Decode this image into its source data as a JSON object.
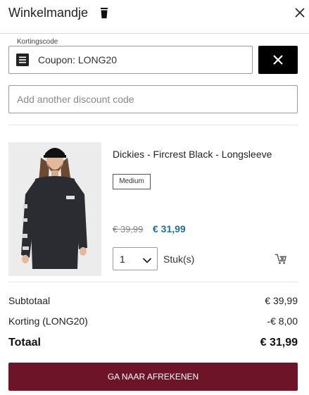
{
  "header": {
    "title": "Winkelmandje",
    "icons": {
      "trash": "trash-icon",
      "close": "close-icon"
    }
  },
  "coupon": {
    "legend": "Kortingscode",
    "applied_label": "Coupon: LONG20",
    "icon": "coupon-list-icon",
    "remove_icon": "close-icon"
  },
  "discount_input": {
    "value": "",
    "placeholder": "Add another discount code"
  },
  "item": {
    "name": "Dickies - Fircrest Black - Longsleeve",
    "size": "Medium",
    "old_price": "€ 39,99",
    "new_price": "€ 31,99",
    "quantity": "1",
    "unit": "Stuk(s)",
    "image": "product-photo",
    "remove_icon": "cart-remove-icon"
  },
  "summary": {
    "subtotal_label": "Subtotaal",
    "subtotal_value": "€ 39,99",
    "discount_label": "Korting (LONG20)",
    "discount_value": "-€ 8,00",
    "total_label": "Totaal",
    "total_value": "€ 31,99"
  },
  "checkout": {
    "label": "GA NAAR AFREKENEN"
  },
  "colors": {
    "checkout_bg": "#6d1428",
    "sale_price": "#1f6f9e",
    "remove_button_bg": "#000000"
  }
}
